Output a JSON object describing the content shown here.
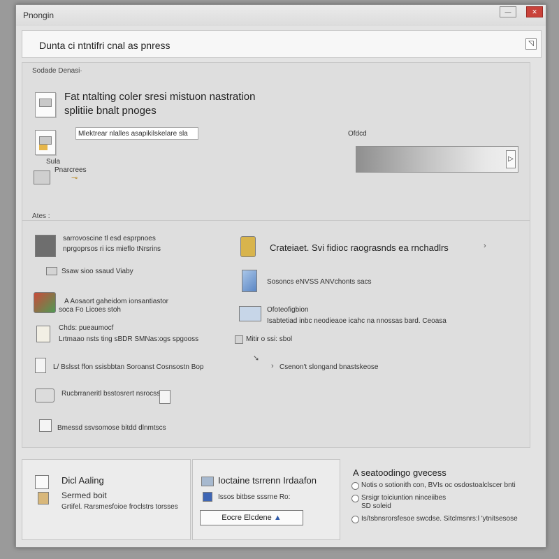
{
  "window": {
    "title": "Pnongin",
    "min_label": "—",
    "close_label": "✕"
  },
  "header": {
    "title": "Dunta ci ntntifri cnal as pnress",
    "corner_icon": "resize-icon",
    "corner_glyph": "◹"
  },
  "main": {
    "section_label": "Sodade Denasi·",
    "top_heading_line1": "Fat ntalting coler sresi mistuon nastration",
    "top_heading_line2": "splitiie bnalt pnoges",
    "field_value": "Mlektrear nlalles asapikilskelare sla",
    "small_label_1": "Sula",
    "small_label_2": "Pnarcrees",
    "preview_label": "Ofdcd",
    "list_label": "Ates :",
    "preview_handle_glyph": "▷",
    "left_items": [
      {
        "line1": "sarrovoscine tl esd esprpnoes",
        "line2": "nprgoprsos ri ics mieflo tNrsrins"
      },
      {
        "line1": "Ssaw sioo ssaud Viaby"
      },
      {
        "line1": "A Aosaort gaheidom ionsantiastor",
        "line2": "soca Fo Licoes stoh"
      },
      {
        "line1": "Chds: pueaumocf",
        "line2": "Lrtmaao nsts ting sBDR SMNas:ogs spgooss"
      },
      {
        "line1": "L/ Bslsst ffon ssisbbtan Soroanst Cosnsostn Bop"
      },
      {
        "line1": "Rucbrraneritl bsstosrert nsrocss"
      },
      {
        "line1": "Bmessd ssvsomose bitdd dlnmtscs"
      }
    ],
    "right_items": [
      {
        "line1": "Crateiaet. Svi fidioc raograsnds ea rnchadlrs"
      },
      {
        "line1": "Sosoncs eNVSS ANVchonts sacs"
      },
      {
        "line1": "Ofoteofigbion",
        "line2": "Isabtetiad inbc neodieaoe icahc na nnossas bard. Ceoasa"
      },
      {
        "line1": "Mitir o ssi: sbol"
      },
      {
        "line1": "Csenon't slongand bnastskeose"
      }
    ]
  },
  "bottom": {
    "left_title": "Dicl Aaling",
    "left_subtitle": "Sermed boit",
    "left_desc": "Grtifel. Rarsmesfoioe froclstrs torsses",
    "mid_title": "Ioctaine tsrrenn Irdaafon",
    "mid_desc": "Issos bitbse sssrne Ro:",
    "mid_button": "Eocre Elcdene",
    "mid_button_glyph": "▲",
    "right_title": "A seatoodingo gvecess",
    "right_options": [
      "Notis o sotionith con, BVIs oc osdostoalclscer bnti",
      "Srsigr toiciuntion ninceiibes",
      "Is/tsbnsrorsfesoe swcdse. Sitclmsnrs:l 'ytnitsesose"
    ],
    "right_option_2b": "SD soleid"
  }
}
